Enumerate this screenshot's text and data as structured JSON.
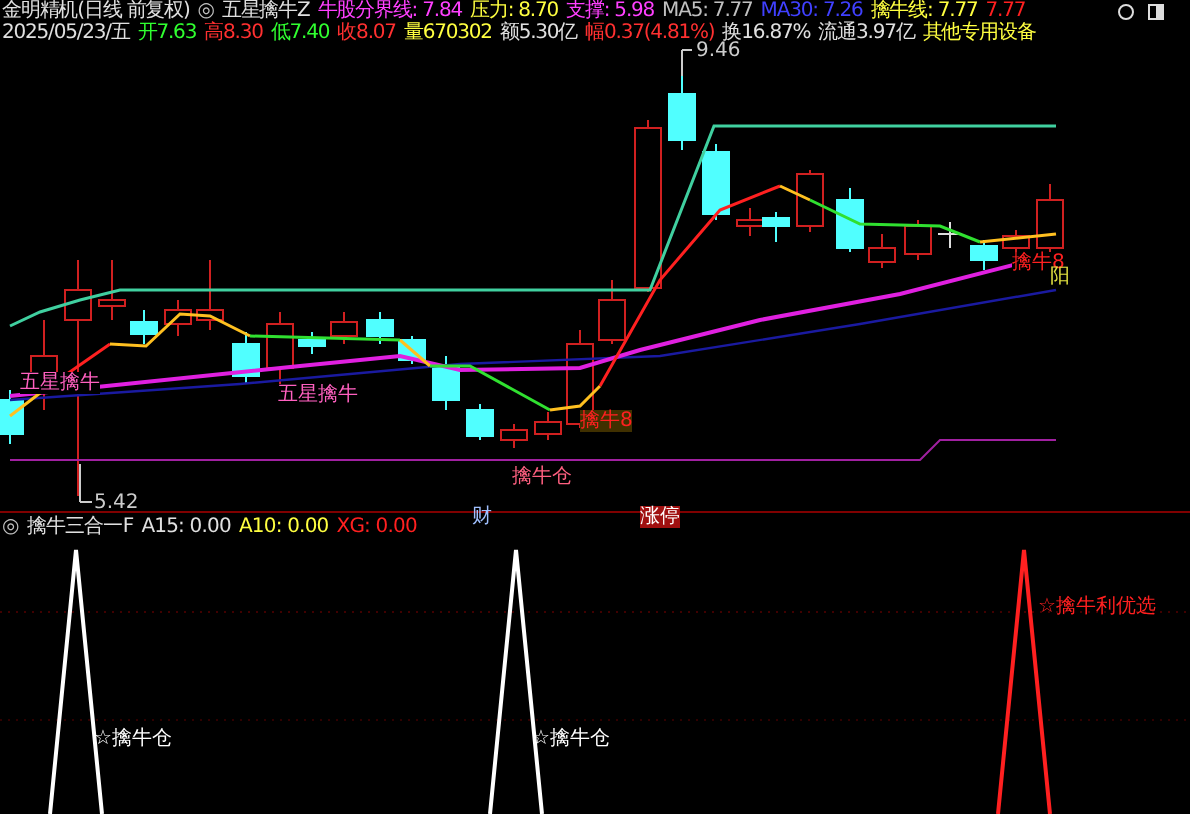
{
  "header": {
    "row1": [
      {
        "text": "金明精机(日线 前复权)",
        "color": "#e0e0e0"
      },
      {
        "text": "◎",
        "color": "#c0c0c0"
      },
      {
        "text": "五星擒牛Z",
        "color": "#e0e0e0"
      },
      {
        "text": "牛股分界线: 7.84",
        "color": "#ff40ff"
      },
      {
        "text": "压力: 8.70",
        "color": "#ffff40"
      },
      {
        "text": "支撑: 5.98",
        "color": "#ff40ff"
      },
      {
        "text": "MA5: 7.77",
        "color": "#c0c0c0"
      },
      {
        "text": "MA30: 7.26",
        "color": "#4040ff"
      },
      {
        "text": "擒牛线: 7.77",
        "color": "#ffff40"
      },
      {
        "text": "7.77",
        "color": "#ff2020"
      }
    ],
    "row2": [
      {
        "text": "2025/05/23/五",
        "color": "#e0e0e0"
      },
      {
        "text": "开7.63",
        "color": "#30ff30"
      },
      {
        "text": "高8.30",
        "color": "#ff3030"
      },
      {
        "text": "低7.40",
        "color": "#30ff30"
      },
      {
        "text": "收8.07",
        "color": "#ff3030"
      },
      {
        "text": "量670302",
        "color": "#ffff40"
      },
      {
        "text": "额5.30亿",
        "color": "#e0e0e0"
      },
      {
        "text": "幅0.37(4.81%)",
        "color": "#ff3030"
      },
      {
        "text": "换16.87%",
        "color": "#e0e0e0"
      },
      {
        "text": "流通3.97亿",
        "color": "#e0e0e0"
      },
      {
        "text": "其他专用设备",
        "color": "#ffff40"
      }
    ]
  },
  "price_chart": {
    "labels": [
      {
        "kind": "signal",
        "text": "五星擒牛"
      },
      {
        "kind": "signal",
        "text": "五星擒牛"
      },
      {
        "kind": "tag",
        "text": "擒牛8"
      },
      {
        "kind": "note",
        "text": "擒牛仓"
      },
      {
        "kind": "low",
        "text": "5.42"
      },
      {
        "kind": "high",
        "text": "9.46"
      },
      {
        "kind": "finance",
        "text": "财"
      },
      {
        "kind": "limit",
        "text": "涨停"
      },
      {
        "kind": "tag_plain",
        "text": "擒牛8"
      },
      {
        "kind": "sun",
        "text": "阳"
      }
    ]
  },
  "indicator": {
    "title": [
      {
        "text": "◎",
        "color": "#c0c0c0"
      },
      {
        "text": "擒牛三合一F",
        "color": "#e0e0e0"
      },
      {
        "text": "A15: 0.00",
        "color": "#e0e0e0"
      },
      {
        "text": "A10: 0.00",
        "color": "#ffff40"
      },
      {
        "text": "XG: 0.00",
        "color": "#ff2020"
      }
    ],
    "labels": [
      {
        "text": "☆擒牛仓"
      },
      {
        "text": "☆擒牛仓"
      },
      {
        "text": "☆擒牛利优选"
      }
    ]
  }
}
